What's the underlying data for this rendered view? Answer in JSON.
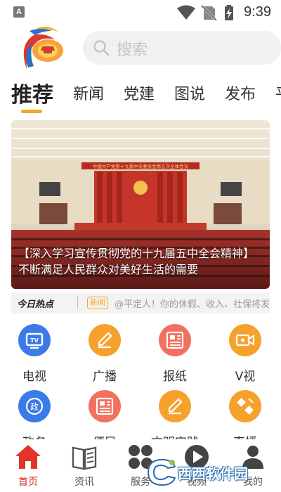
{
  "status_bar": {
    "time": "9:39",
    "notification_icon": "A"
  },
  "search": {
    "placeholder": "搜索"
  },
  "tabs": [
    {
      "label": "推荐",
      "active": true
    },
    {
      "label": "新闻"
    },
    {
      "label": "党建"
    },
    {
      "label": "图说"
    },
    {
      "label": "发布"
    },
    {
      "label": "平"
    }
  ],
  "banner": {
    "caption": "【深入学习宣传贯彻党的十九届五中全会精神】不断满足人民群众对美好生活的需要",
    "backdrop_text": "中国共产党第十九届中央委员会第五次全体会议"
  },
  "hot": {
    "title": "今日热点",
    "tag": "新闻",
    "text": "@平定人！你的休假、收入、社保将发生"
  },
  "grid": [
    {
      "label": "电视",
      "icon": "tv-icon",
      "color": "#3b7be8"
    },
    {
      "label": "广播",
      "icon": "edit-icon",
      "color": "#f7a12d"
    },
    {
      "label": "报纸",
      "icon": "newspaper-icon",
      "color": "#f2705e"
    },
    {
      "label": "V视",
      "icon": "video-camera-icon",
      "color": "#f7a12d"
    },
    {
      "label": "政务",
      "icon": "government-icon",
      "color": "#3b7be8"
    },
    {
      "label": "便民",
      "icon": "newspaper-icon",
      "color": "#f2705e"
    },
    {
      "label": "文明实践",
      "icon": "edit-icon",
      "color": "#f7a12d"
    },
    {
      "label": "直播",
      "icon": "live-icon",
      "color": "#f7a12d"
    }
  ],
  "bottom_nav": [
    {
      "label": "首页",
      "icon": "home-icon",
      "active": true
    },
    {
      "label": "资讯",
      "icon": "book-icon"
    },
    {
      "label": "服务",
      "icon": "apps-icon"
    },
    {
      "label": "视频",
      "icon": "play-icon"
    },
    {
      "label": "我的",
      "icon": "user-icon"
    }
  ],
  "watermark": {
    "text": "西西软件园"
  },
  "colors": {
    "accent": "#f5a623",
    "nav_active": "#e0352b"
  }
}
